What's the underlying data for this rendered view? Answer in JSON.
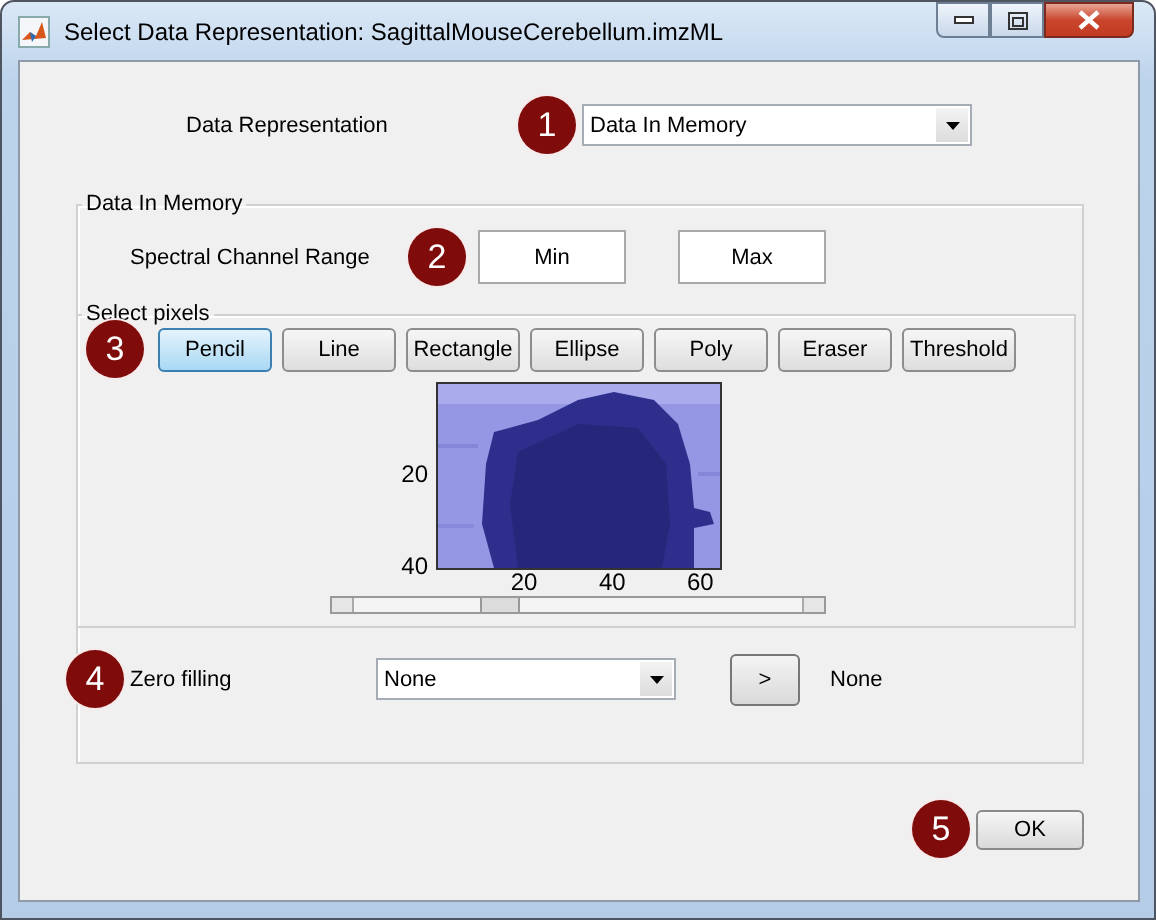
{
  "window": {
    "title": "Select Data Representation: SagittalMouseCerebellum.imzML"
  },
  "data_representation": {
    "label": "Data Representation",
    "value": "Data In Memory",
    "callout": "1"
  },
  "panel": {
    "title": "Data In Memory",
    "range": {
      "label": "Spectral Channel Range",
      "callout": "2",
      "min": "Min",
      "max": "Max"
    },
    "select_pixels": {
      "title": "Select pixels",
      "callout": "3",
      "tools": [
        {
          "label": "Pencil",
          "selected": true
        },
        {
          "label": "Line",
          "selected": false
        },
        {
          "label": "Rectangle",
          "selected": false
        },
        {
          "label": "Ellipse",
          "selected": false
        },
        {
          "label": "Poly",
          "selected": false
        },
        {
          "label": "Eraser",
          "selected": false
        },
        {
          "label": "Threshold",
          "selected": false
        }
      ],
      "image": {
        "kind": "picture",
        "yticks": [
          "20",
          "40"
        ],
        "xticks": [
          "20",
          "40",
          "60"
        ]
      }
    },
    "zero_filling": {
      "label": "Zero filling",
      "callout": "4",
      "value": "None",
      "button": ">",
      "result": "None"
    }
  },
  "ok": {
    "label": "OK",
    "callout": "5"
  }
}
